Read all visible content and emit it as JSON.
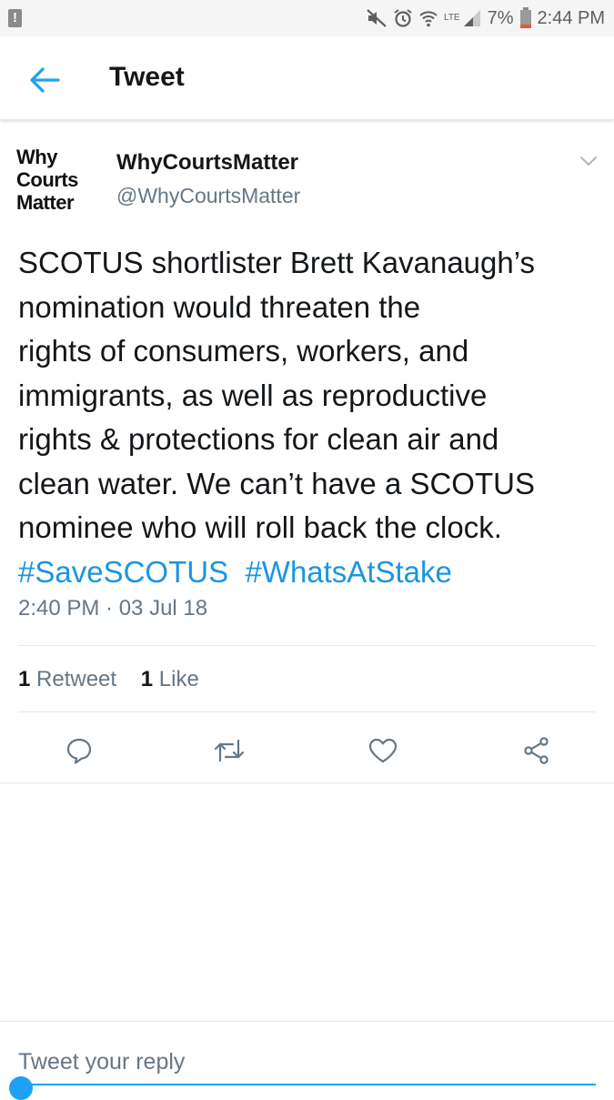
{
  "status_bar": {
    "alert_icon": "!",
    "network": "LTE",
    "battery": "7%",
    "time": "2:44 PM"
  },
  "app_bar": {
    "title": "Tweet"
  },
  "tweet": {
    "avatar_lines": [
      "Why",
      "Courts",
      "Matter"
    ],
    "author_name": "WhyCourtsMatter",
    "author_handle": "@WhyCourtsMatter",
    "text_lines": [
      "SCOTUS shortlister Brett Kavanaugh’s",
      "nomination would threaten the",
      "rights of consumers, workers, and",
      "immigrants, as well as reproductive",
      "rights & protections for clean air and",
      "clean water. We can’t have a SCOTUS",
      "nominee who will roll back the clock."
    ],
    "hashtags": [
      "#SaveSCOTUS",
      "#WhatsAtStake"
    ],
    "timestamp": "2:40 PM · 03 Jul 18",
    "retweet_count": "1",
    "retweet_label": "Retweet",
    "like_count": "1",
    "like_label": "Like"
  },
  "reply": {
    "placeholder": "Tweet your reply"
  },
  "colors": {
    "accent": "#1da1f2",
    "hashtag": "#1b95e0",
    "secondary_text": "#657786"
  },
  "icons": {
    "back": "arrow-left-icon",
    "caret": "chevron-down-icon",
    "reply": "reply-icon",
    "retweet": "retweet-icon",
    "like": "heart-icon",
    "share": "share-icon"
  }
}
